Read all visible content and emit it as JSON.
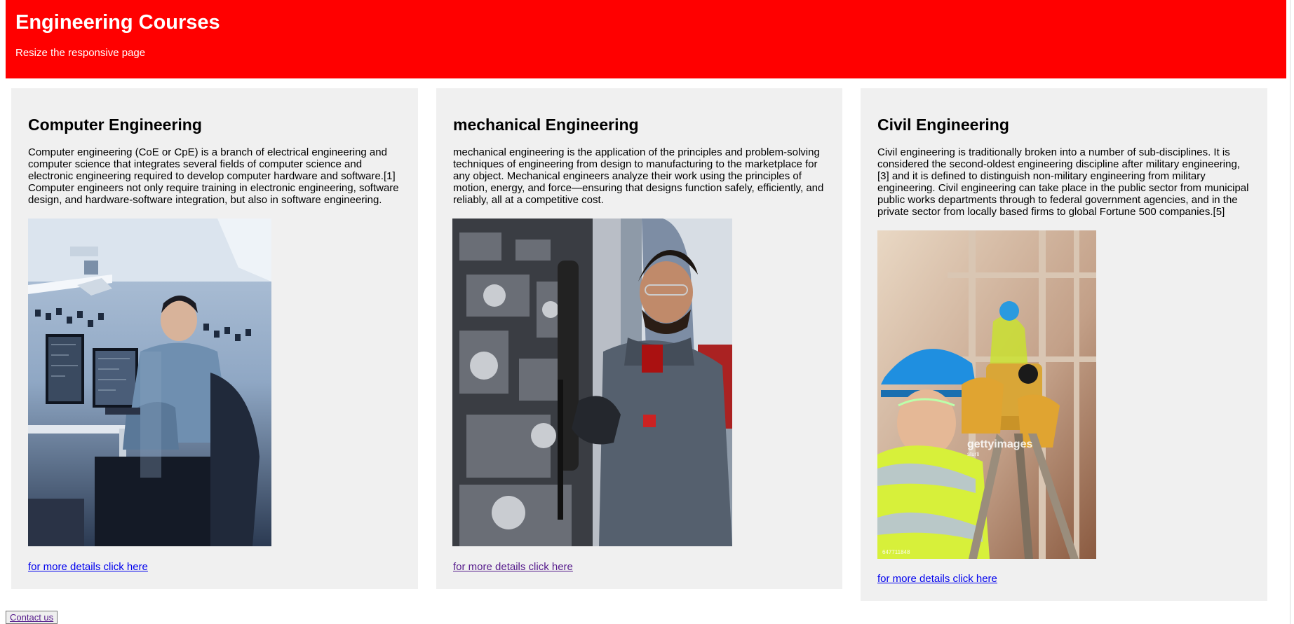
{
  "header": {
    "title": "Engineering Courses",
    "subtitle": "Resize the responsive page"
  },
  "cards": [
    {
      "title": "Computer Engineering",
      "description": "Computer engineering (CoE or CpE) is a branch of electrical engineering and computer science that integrates several fields of computer science and electronic engineering required to develop computer hardware and software.[1] Computer engineers not only require training in electronic engineering, software design, and hardware-software integration, but also in software engineering.",
      "link": "for more details click here"
    },
    {
      "title": "mechanical Engineering",
      "description": "mechanical engineering is the application of the principles and problem-solving techniques of engineering from design to manufacturing to the marketplace for any object. Mechanical engineers analyze their work using the principles of motion, energy, and force—ensuring that designs function safely, efficiently, and reliably, all at a competitive cost.",
      "link": "for more details click here"
    },
    {
      "title": "Civil Engineering",
      "description": "Civil engineering is traditionally broken into a number of sub-disciplines. It is considered the second-oldest engineering discipline after military engineering,[3] and it is defined to distinguish non-military engineering from military engineering. Civil engineering can take place in the public sector from municipal public works departments through to federal government agencies, and in the private sector from locally based firms to global Fortune 500 companies.[5]",
      "link": "for more details click here",
      "watermark": "gettyimages",
      "watermark_credit": "sturti",
      "image_id": "647711848"
    }
  ],
  "footer": {
    "contact_label": "Contact us"
  }
}
